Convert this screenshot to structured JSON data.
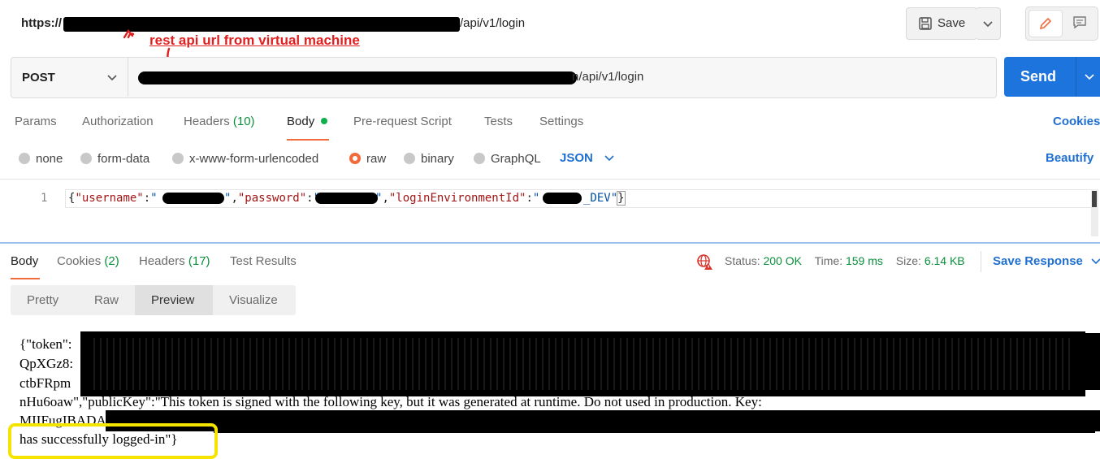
{
  "header": {
    "url_prefix": "https://",
    "url_suffix": "/api/v1/login",
    "save_label": "Save"
  },
  "annotation": {
    "text": "rest api url from virtual machine",
    "color": "#e02020"
  },
  "request": {
    "method": "POST",
    "url_suffix": "n/api/v1/login",
    "send_label": "Send"
  },
  "request_tabs": [
    {
      "label": "Params"
    },
    {
      "label": "Authorization"
    },
    {
      "label": "Headers",
      "count": "(10)"
    },
    {
      "label": "Body"
    },
    {
      "label": "Pre-request Script"
    },
    {
      "label": "Tests"
    },
    {
      "label": "Settings"
    }
  ],
  "cookies_link": "Cookies",
  "body_types": [
    "none",
    "form-data",
    "x-www-form-urlencoded",
    "raw",
    "binary",
    "GraphQL"
  ],
  "body_format": "JSON",
  "beautify_label": "Beautify",
  "editor": {
    "line_number": "1",
    "brace_open": "{",
    "key_username": "\"username\"",
    "key_password": "\"password\"",
    "key_env": "\"loginEnvironmentId\"",
    "colon": ":",
    "comma": ",",
    "quote": "\"",
    "env_suffix": "_DEV\"",
    "brace_close": "}"
  },
  "response_tabs": [
    {
      "label": "Body"
    },
    {
      "label": "Cookies",
      "count": "(2)"
    },
    {
      "label": "Headers",
      "count": "(17)"
    },
    {
      "label": "Test Results"
    }
  ],
  "status": {
    "status_label": "Status:",
    "status_value": "200 OK",
    "time_label": "Time:",
    "time_value": "159 ms",
    "size_label": "Size:",
    "size_value": "6.14 KB",
    "save_response": "Save Response"
  },
  "view_modes": [
    "Pretty",
    "Raw",
    "Preview",
    "Visualize"
  ],
  "preview": {
    "line1": "{\"token\":",
    "line2": "QpXGz8:",
    "line3": "ctbFRpm",
    "line4": "nHu6oaw\",\"publicKey\":\"This token is signed with the following key, but it was generated at runtime. Do not used in production. Key:",
    "line5": "MIIFugIBADAN",
    "line6": "has successfully logged-in\"}"
  },
  "colors": {
    "accent_blue": "#1f6fd1",
    "send_blue": "#1e74dd",
    "status_green": "#0a8f3c",
    "raw_orange": "#f26b3a",
    "highlight_yellow": "#f5e400"
  }
}
